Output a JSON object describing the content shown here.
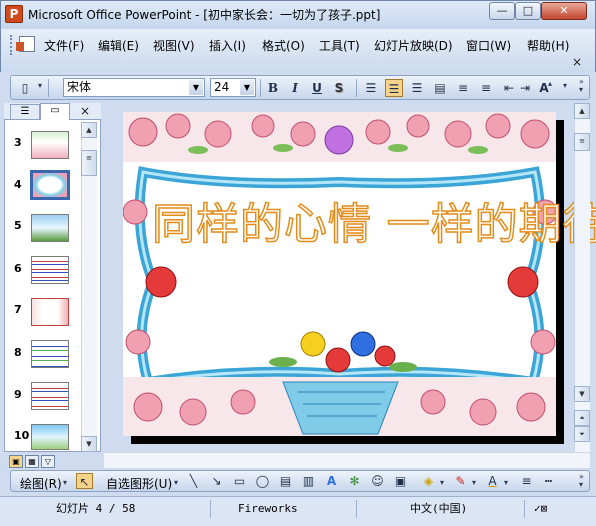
{
  "window": {
    "title": "Microsoft Office PowerPoint - [初中家长会：一切为了孩子.ppt]",
    "app_icon_letter": "P",
    "minimize": "—",
    "maximize": "□",
    "close": "✕"
  },
  "menu": {
    "items": [
      "文件(F)",
      "编辑(E)",
      "视图(V)",
      "插入(I)",
      "格式(O)",
      "工具(T)",
      "幻灯片放映(D)",
      "窗口(W)",
      "帮助(H)"
    ],
    "close": "×"
  },
  "format_toolbar": {
    "font_name": "宋体",
    "font_size": "24",
    "bold": "B",
    "italic": "I",
    "underline": "U",
    "shadow": "S",
    "grow_font": "A"
  },
  "slide_panel": {
    "tab_close": "×",
    "thumbnails": [
      {
        "number": "3",
        "selected": false
      },
      {
        "number": "4",
        "selected": true
      },
      {
        "number": "5",
        "selected": false
      },
      {
        "number": "6",
        "selected": false
      },
      {
        "number": "7",
        "selected": false
      },
      {
        "number": "8",
        "selected": false
      },
      {
        "number": "9",
        "selected": false
      },
      {
        "number": "10",
        "selected": false
      }
    ]
  },
  "slide": {
    "title": "同样的心情 一样的期待",
    "title_color": "#e38c1a"
  },
  "draw_toolbar": {
    "draw_label": "绘图(R)",
    "autoshapes_label": "自选图形(U)"
  },
  "status": {
    "slide_position": "幻灯片 4 / 58",
    "design": "Fireworks",
    "language": "中文(中国)"
  },
  "colors": {
    "accent": "#3a67b0",
    "chrome": "#cfdcef",
    "selected_button": "#f6d38a"
  }
}
